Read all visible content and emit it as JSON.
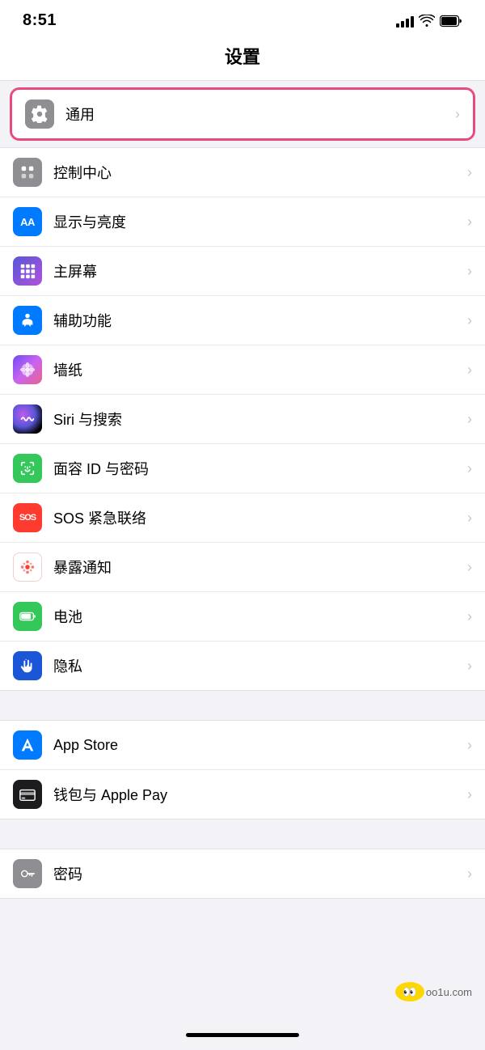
{
  "statusBar": {
    "time": "8:51",
    "signal": "signal-icon",
    "wifi": "wifi-icon",
    "battery": "battery-icon"
  },
  "header": {
    "title": "设置"
  },
  "sections": [
    {
      "id": "general",
      "highlighted": true,
      "items": [
        {
          "id": "general",
          "label": "通用",
          "iconType": "gear",
          "iconBg": "gray",
          "chevron": "›"
        }
      ]
    },
    {
      "id": "system",
      "highlighted": false,
      "items": [
        {
          "id": "control-center",
          "label": "控制中心",
          "iconType": "control",
          "iconBg": "gray",
          "chevron": "›"
        },
        {
          "id": "display",
          "label": "显示与亮度",
          "iconType": "aa",
          "iconBg": "blue",
          "chevron": "›"
        },
        {
          "id": "home-screen",
          "label": "主屏幕",
          "iconType": "grid",
          "iconBg": "purple",
          "chevron": "›"
        },
        {
          "id": "accessibility",
          "label": "辅助功能",
          "iconType": "person",
          "iconBg": "teal",
          "chevron": "›"
        },
        {
          "id": "wallpaper",
          "label": "墙纸",
          "iconType": "flower",
          "iconBg": "wallpaper",
          "chevron": "›"
        },
        {
          "id": "siri",
          "label": "Siri 与搜索",
          "iconType": "siri",
          "iconBg": "siri",
          "chevron": "›"
        },
        {
          "id": "faceid",
          "label": "面容 ID 与密码",
          "iconType": "faceid",
          "iconBg": "green",
          "chevron": "›"
        },
        {
          "id": "sos",
          "label": "SOS 紧急联络",
          "iconType": "sos",
          "iconBg": "red",
          "chevron": "›"
        },
        {
          "id": "exposure",
          "label": "暴露通知",
          "iconType": "exposure",
          "iconBg": "exposure",
          "chevron": "›"
        },
        {
          "id": "battery",
          "label": "电池",
          "iconType": "battery",
          "iconBg": "battery-green",
          "chevron": "›"
        },
        {
          "id": "privacy",
          "label": "隐私",
          "iconType": "hand",
          "iconBg": "privacy-blue",
          "chevron": "›"
        }
      ]
    },
    {
      "id": "apps",
      "highlighted": false,
      "items": [
        {
          "id": "appstore",
          "label": "App Store",
          "iconType": "appstore",
          "iconBg": "appstore-blue",
          "chevron": "›"
        },
        {
          "id": "wallet",
          "label": "钱包与 Apple Pay",
          "iconType": "wallet",
          "iconBg": "wallet-dark",
          "chevron": "›"
        }
      ]
    },
    {
      "id": "password-section",
      "highlighted": false,
      "items": [
        {
          "id": "passwords",
          "label": "密码",
          "iconType": "key",
          "iconBg": "password-gray",
          "chevron": "›"
        }
      ]
    }
  ],
  "watermark": "oo1u.com"
}
